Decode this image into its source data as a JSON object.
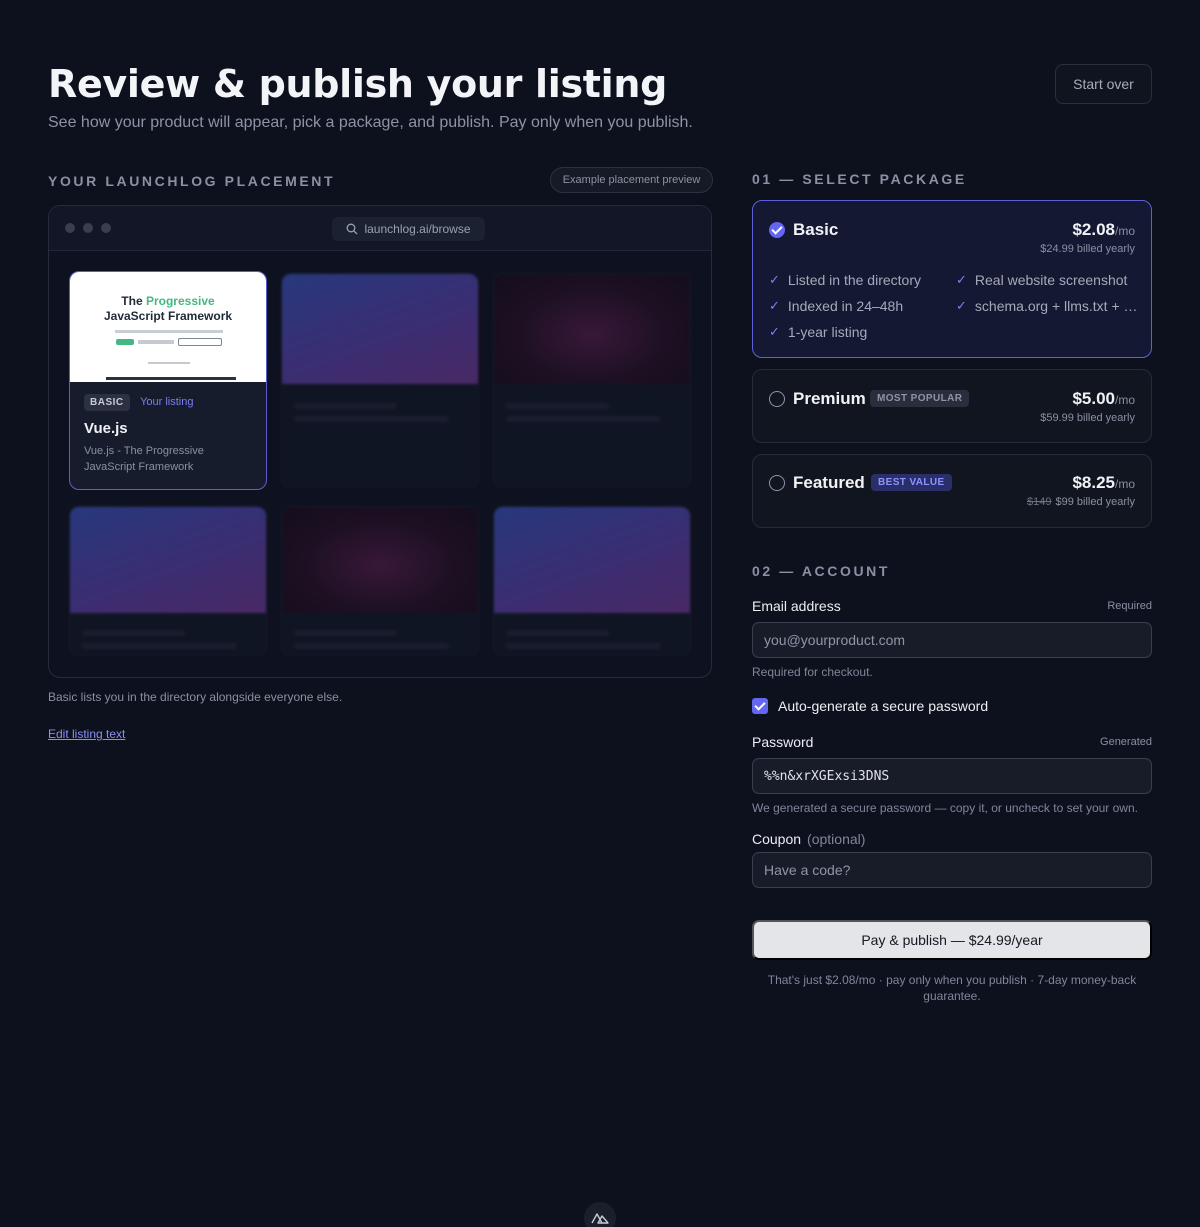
{
  "header": {
    "title": "Review & publish your listing",
    "subtitle": "See how your product will appear, pick a package, and publish. Pay only when you publish.",
    "start_over": "Start over"
  },
  "placement": {
    "heading": "YOUR LAUNCHLOG PLACEMENT",
    "preview_badge": "Example placement preview",
    "url": "launchlog.ai/browse",
    "own_card": {
      "thumb_headline_1": "The ",
      "thumb_headline_accent": "Progressive",
      "thumb_headline_2": "JavaScript Framework",
      "tier": "BASIC",
      "your_listing": "Your listing",
      "name": "Vue.js",
      "description": "Vue.js - The Progressive JavaScript Framework"
    },
    "note": "Basic lists you in the directory alongside everyone else.",
    "edit_link": "Edit listing text"
  },
  "packages": {
    "heading": "01 — SELECT PACKAGE",
    "items": [
      {
        "name": "Basic",
        "price": "$2.08",
        "per": "/mo",
        "billed": "$24.99 billed yearly",
        "selected": true,
        "features": [
          "Listed in the directory",
          "Real website screenshot",
          "Indexed in 24–48h",
          "schema.org + llms.txt + …",
          "1-year listing"
        ]
      },
      {
        "name": "Premium",
        "badge": "MOST POPULAR",
        "price": "$5.00",
        "per": "/mo",
        "billed": "$59.99 billed yearly"
      },
      {
        "name": "Featured",
        "badge": "BEST VALUE",
        "price": "$8.25",
        "per": "/mo",
        "old_price": "$149",
        "billed": "$99 billed yearly"
      }
    ]
  },
  "account": {
    "heading": "02 — ACCOUNT",
    "email_label": "Email address",
    "email_hint": "Required",
    "email_placeholder": "you@yourproduct.com",
    "email_help": "Required for checkout.",
    "auto_password_label": "Auto-generate a secure password",
    "auto_password_checked": true,
    "password_label": "Password",
    "password_hint": "Generated",
    "password_value": "%%n&xrXGExsi3DNS",
    "password_help": "We generated a secure password — copy it, or uncheck to set your own.",
    "coupon_label": "Coupon",
    "coupon_optional": "(optional)",
    "coupon_placeholder": "Have a code?",
    "pay_button": "Pay & publish — $24.99/year",
    "fine_print": "That's just $2.08/mo · pay only when you publish · 7-day money-back guarantee."
  },
  "colors": {
    "background": "#0d111e",
    "accent": "#6366f1",
    "selected_border": "#5d61d8"
  }
}
